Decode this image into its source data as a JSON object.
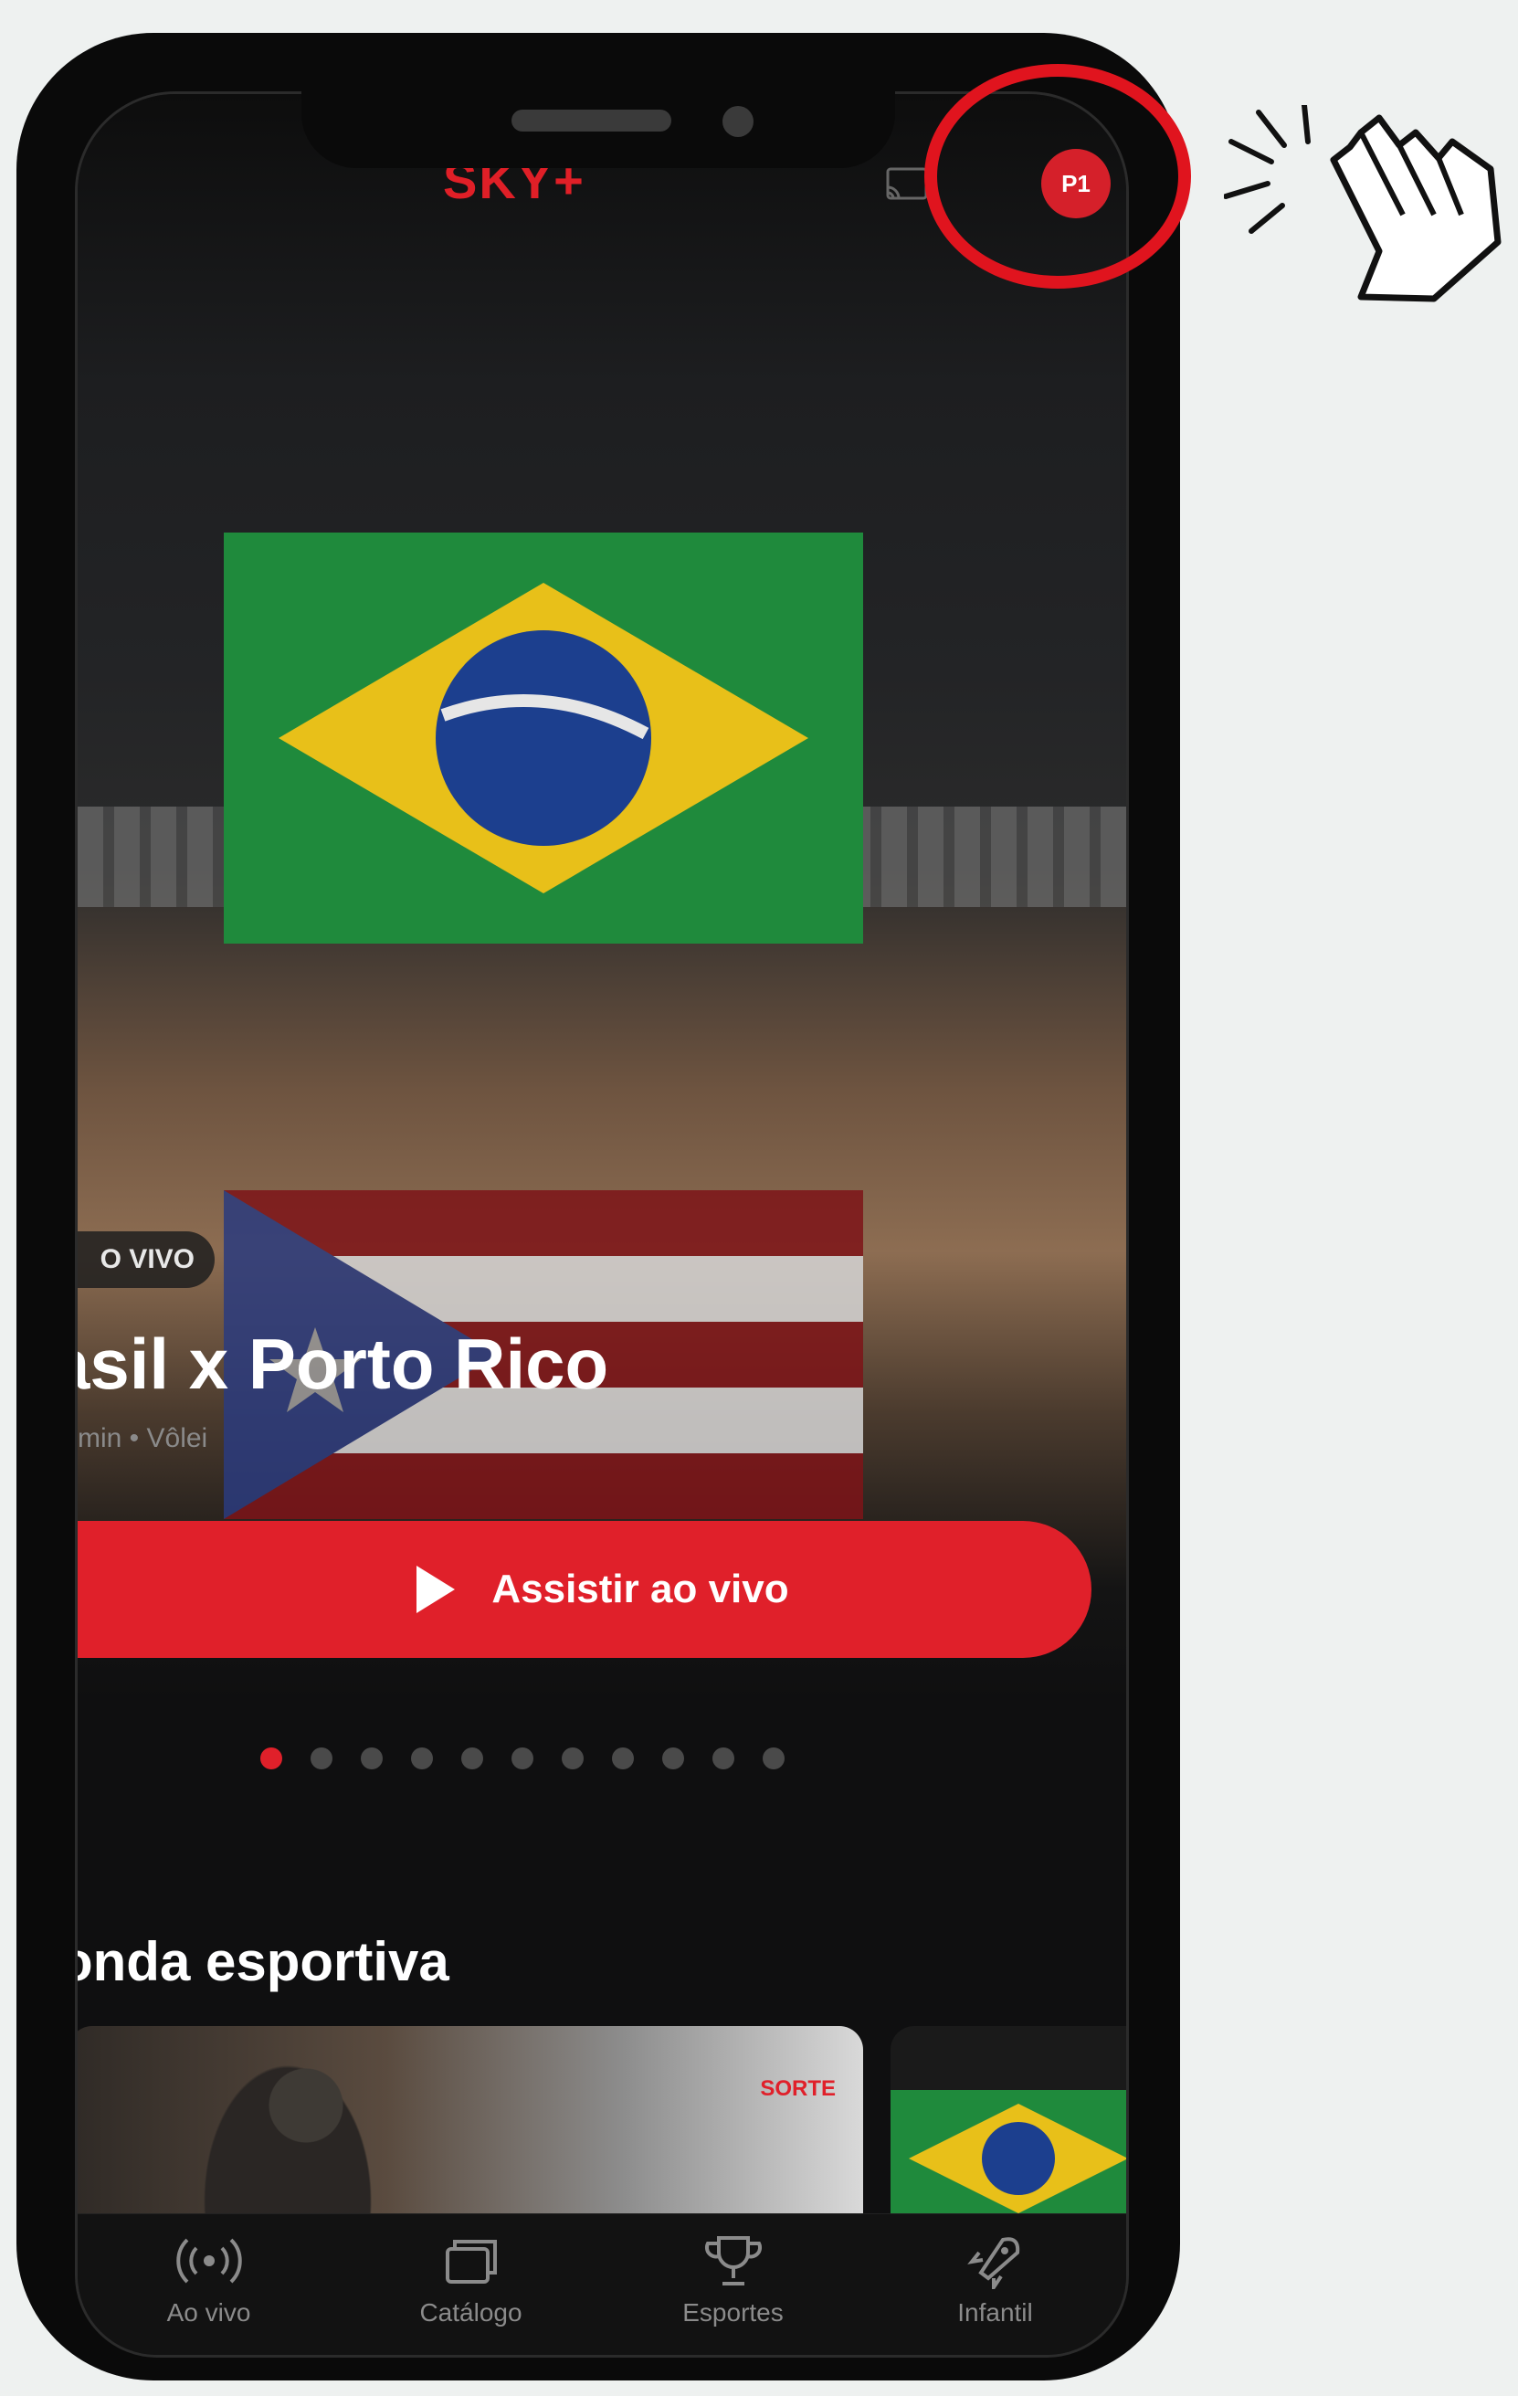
{
  "app": {
    "logo_text": "SKY+",
    "profile_initials": "P1",
    "brand_color": "#e0202a"
  },
  "hero": {
    "badge": "O VIVO",
    "title": "asil x Porto Rico",
    "meta": "min • Vôlei",
    "watch_button": "Assistir ao vivo",
    "carousel": {
      "total": 11,
      "active_index": 0
    }
  },
  "section": {
    "title": "onda esportiva",
    "card_tag": "SORTE"
  },
  "bottom_nav": {
    "items": [
      {
        "label": "Ao vivo",
        "icon": "live-broadcast-icon"
      },
      {
        "label": "Catálogo",
        "icon": "catalog-icon"
      },
      {
        "label": "Esportes",
        "icon": "trophy-icon"
      },
      {
        "label": "Infantil",
        "icon": "rocket-icon"
      }
    ]
  },
  "annotation": {
    "ring_color": "#e0141e",
    "pointer_icon": "hand-click-icon"
  }
}
